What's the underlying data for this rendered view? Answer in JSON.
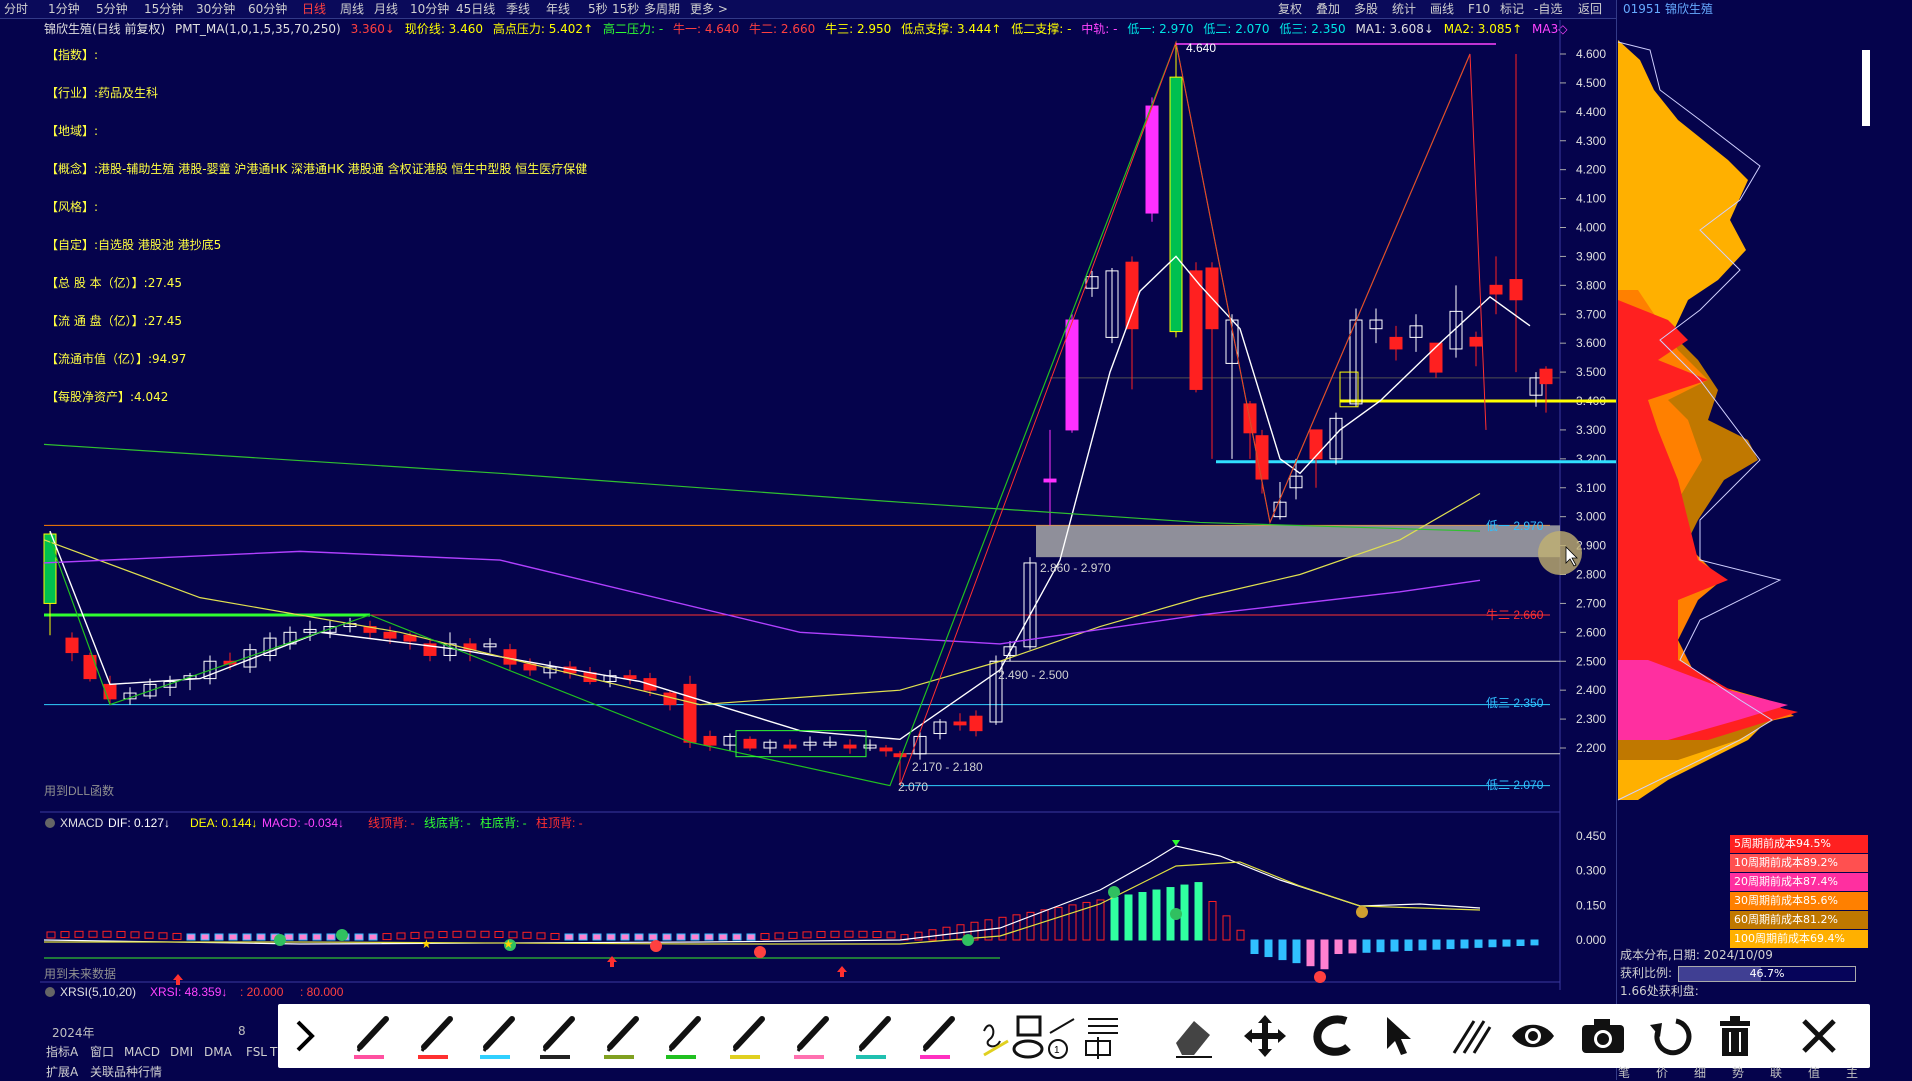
{
  "top_tabs": [
    "分时",
    "1分钟",
    "5分钟",
    "15分钟",
    "30分钟",
    "60分钟",
    "日线",
    "周线",
    "月线",
    "10分钟",
    "45日线",
    "季线",
    "年线",
    "5秒",
    "15秒",
    "多周期",
    "更多 >"
  ],
  "top_tabs_active": "日线",
  "top_right_tabs": [
    "复权",
    "叠加",
    "多股",
    "统计",
    "画线",
    "F10",
    "标记",
    "-自选",
    "返回"
  ],
  "stock_title": "01951 锦欣生殖",
  "info_bar": {
    "name": "锦欣生殖(日线 前复权)",
    "indicator": "PMT_MA(1,0,1,5,35,70,250)",
    "price1": "3.360↓",
    "now_line": "现价线: 3.460",
    "high_pressure": "高点压力: 5.402↑",
    "gao2": "高二压力: -",
    "niu1": "牛一: 4.640",
    "niu2": "牛二: 2.660",
    "niu3": "牛三: 2.950",
    "low_support": "低点支撑: 3.444↑",
    "low2_support": "低二支撑: -",
    "mid": "中轨: -",
    "di1": "低一: 2.970",
    "di2": "低二: 2.070",
    "di3": "低三: 2.350",
    "ma1": "MA1: 3.608↓",
    "ma2": "MA2: 3.085↑",
    "ma3": "MA3◇"
  },
  "left_info": [
    {
      "k": "【指数】:",
      "v": ""
    },
    {
      "k": "【行业】:",
      "v": "药品及生科"
    },
    {
      "k": "【地域】:",
      "v": ""
    },
    {
      "k": "【概念】:",
      "v": "港股-辅助生殖 港股-婴童 沪港通HK 深港通HK 港股通 含权证港股 恒生中型股 恒生医疗保健"
    },
    {
      "k": "【风格】:",
      "v": ""
    },
    {
      "k": "【自定】:",
      "v": "自选股 港股池 港抄底5"
    },
    {
      "k": "【总 股 本（亿）】:",
      "v": "27.45"
    },
    {
      "k": "【流 通 盘（亿）】:",
      "v": "27.45"
    },
    {
      "k": "【流通市值（亿）】:",
      "v": "94.97"
    },
    {
      "k": "【每股净资产】:",
      "v": "4.042"
    }
  ],
  "price_axis": [
    "4.600",
    "4.500",
    "4.400",
    "4.300",
    "4.200",
    "4.100",
    "4.000",
    "3.900",
    "3.800",
    "3.700",
    "3.600",
    "3.500",
    "3.400",
    "3.300",
    "3.200",
    "3.100",
    "3.000",
    "2.900",
    "2.800",
    "2.700",
    "2.600",
    "2.500",
    "2.400",
    "2.300",
    "2.200"
  ],
  "chart_labels": {
    "peak": "4.640",
    "box1": "2.860 - 2.970",
    "box2": "2.490 - 2.500",
    "box3": "2.170 - 2.180",
    "low": "2.070",
    "lo1": "低一 2.970",
    "niu2": "牛二 2.660",
    "lo3": "低三 2.350",
    "lo2": "低二 2.070",
    "big1": "3.4",
    "big2": "3.19",
    "dll_note": "用到DLL函数",
    "future_note": "用到未来数据"
  },
  "macd_bar": {
    "title": "XMACD",
    "dif": "DIF: 0.127↓",
    "dea": "DEA: 0.144↓",
    "macd": "MACD: -0.034↓",
    "a": "线顶背: -",
    "b": "线底背: -",
    "c": "柱底背: -",
    "d": "柱顶背: -"
  },
  "macd_axis": [
    "0.450",
    "0.300",
    "0.150",
    "0.000"
  ],
  "rsi_bar": {
    "title": "XRSI(5,10,20)",
    "rsi": "XRSI: 48.359↓",
    "v20": ": 20.000",
    "v80": ": 80.000"
  },
  "cost_legend": [
    {
      "label": "5周期前成本94.5%",
      "color": "#ff2020"
    },
    {
      "label": "10周期前成本89.2%",
      "color": "#ff5050"
    },
    {
      "label": "20周期前成本87.4%",
      "color": "#ff2fa0"
    },
    {
      "label": "30周期前成本85.6%",
      "color": "#ff8000"
    },
    {
      "label": "60周期前成本81.2%",
      "color": "#c07800"
    },
    {
      "label": "100周期前成本69.4%",
      "color": "#ffb000"
    }
  ],
  "right_info": {
    "date": "成本分布,日期: 2024/10/09",
    "profit_label": "获利比例:",
    "profit_value": "46.7%",
    "profit_frac": 0.467,
    "extra": "1.66处获利盘:"
  },
  "date_labels": {
    "year": "2024年",
    "month": "8"
  },
  "bottom_tabs": [
    "指标A",
    "窗口",
    "MACD",
    "DMI",
    "DMA",
    "FSL",
    "T"
  ],
  "bottom_tabs2": [
    "扩展A",
    "关联品种行情"
  ],
  "status_right": [
    "笔",
    "价",
    "细",
    "势",
    "联",
    "值",
    "主"
  ],
  "toolbar_tools": [
    "chevron-icon",
    "pen-icon-pink",
    "pen-icon-red",
    "pen-icon-cyan",
    "pen-icon-black",
    "pen-icon-olive",
    "marker-icon-green",
    "pen-icon-yellow",
    "pen-icon-pink2",
    "pen-icon-teal",
    "marker-icon-magenta",
    "shapes-icon",
    "eraser-icon",
    "move-icon",
    "magnet-icon",
    "pointer-icon",
    "hatch-icon",
    "eye-icon",
    "camera-icon",
    "undo-icon",
    "trash-icon",
    "close-icon"
  ],
  "colors": {
    "bg": "#05034c",
    "up": "#ff2020",
    "down": "#00e0e0",
    "ma": "#ffff00"
  }
}
